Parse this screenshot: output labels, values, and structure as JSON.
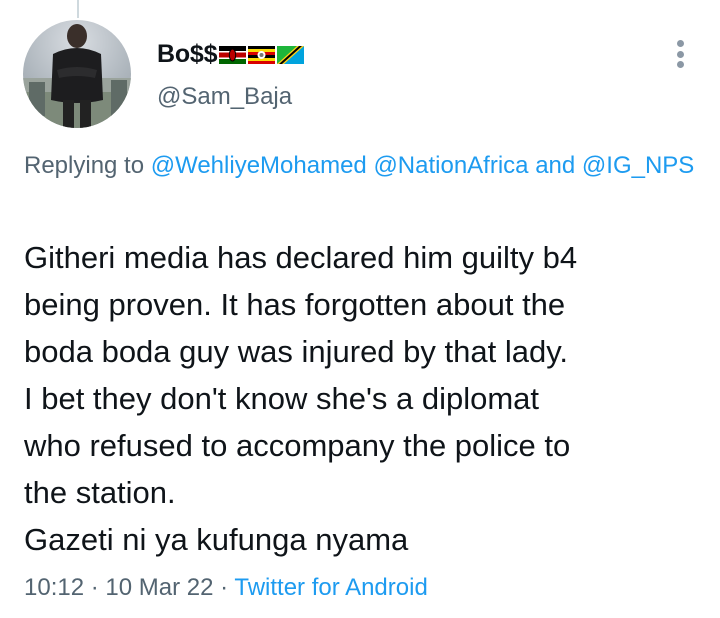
{
  "tweet": {
    "author": {
      "display_name": "Bo$$",
      "flags": [
        "kenya-flag",
        "uganda-flag",
        "tanzania-flag"
      ],
      "handle": "@Sam_Baja"
    },
    "replying_to": {
      "prefix": "Replying to",
      "mention_1": "@WehliyeMohamed",
      "mention_2": "@NationAfrica",
      "conjunction": "and",
      "mention_3": "@IG_NPS"
    },
    "text_lines": [
      "Githeri media has declared him guilty b4",
      "being proven. It has forgotten about the",
      "boda boda guy was injured by that lady.",
      "I bet they don't know she's a diplomat",
      "who refused to accompany the police to",
      "the station.",
      "Gazeti ni ya kufunga nyama"
    ],
    "time": "10:12",
    "separator": "·",
    "date": "10 Mar 22",
    "source": "Twitter for Android"
  },
  "colors": {
    "link": "#1d9bf0",
    "secondary_text": "#536471",
    "primary_text": "#0f1419"
  },
  "icons": {
    "more": "more-vertical-icon"
  }
}
